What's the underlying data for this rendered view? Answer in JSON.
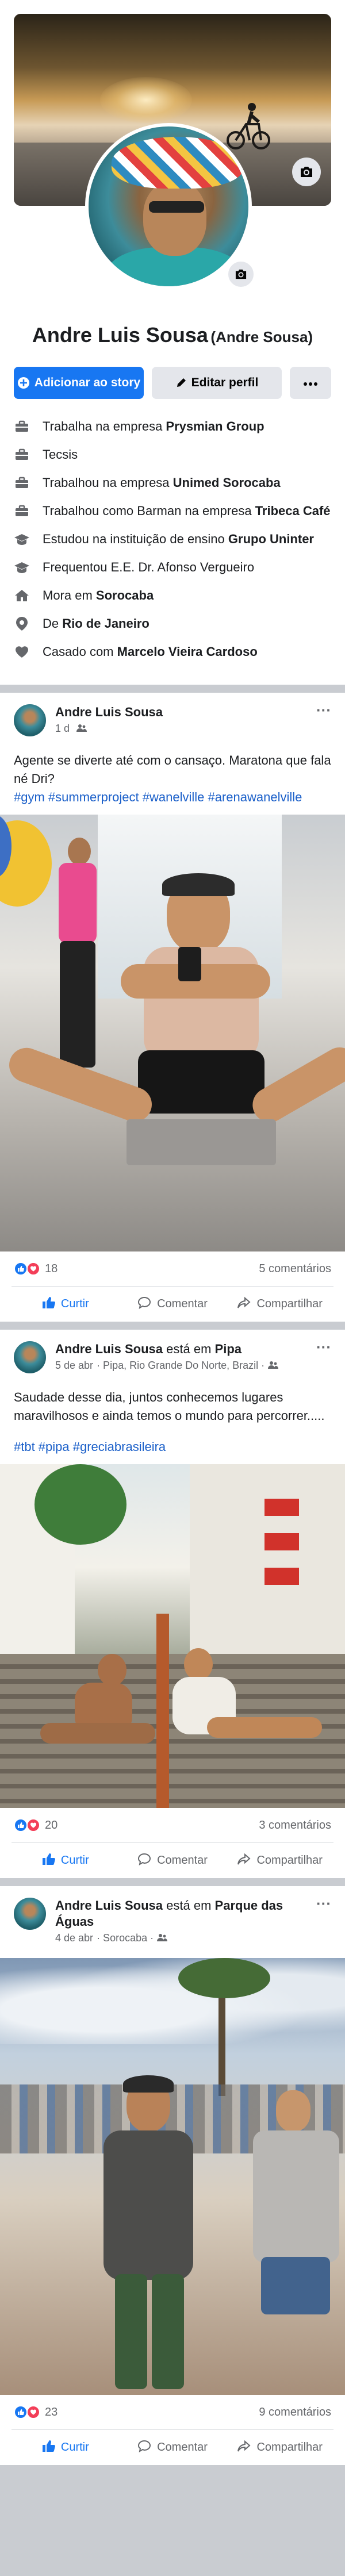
{
  "profile": {
    "name": "Andre Luis Sousa",
    "alternate_name": "(Andre Sousa)",
    "add_story_label": "Adicionar ao story",
    "edit_profile_label": "Editar perfil"
  },
  "about": [
    {
      "icon": "briefcase-icon",
      "prefix": "Trabalha na empresa ",
      "bold": "Prysmian Group"
    },
    {
      "icon": "briefcase-icon",
      "prefix": "Tecsis",
      "bold": ""
    },
    {
      "icon": "briefcase-icon",
      "prefix": "Trabalhou na empresa ",
      "bold": "Unimed Sorocaba"
    },
    {
      "icon": "briefcase-icon",
      "prefix": "Trabalhou como Barman na empresa ",
      "bold": "Tribeca Café"
    },
    {
      "icon": "graduation-cap-icon",
      "prefix": "Estudou na instituição de ensino ",
      "bold": "Grupo Uninter"
    },
    {
      "icon": "graduation-cap-icon",
      "prefix": "Frequentou E.E. Dr. Afonso Vergueiro",
      "bold": ""
    },
    {
      "icon": "home-icon",
      "prefix": "Mora em ",
      "bold": "Sorocaba"
    },
    {
      "icon": "location-pin-icon",
      "prefix": "De ",
      "bold": "Rio de Janeiro"
    },
    {
      "icon": "heart-icon",
      "prefix": "Casado com ",
      "bold": "Marcelo Vieira Cardoso"
    }
  ],
  "posts": [
    {
      "author": "Andre Luis Sousa",
      "place_prefix": "",
      "place": "",
      "date": "1 d",
      "location": "",
      "text": "Agente se diverte até com o cansaço. Maratona que fala né Dri?",
      "tags": "#gym #summerproject  #wanelville #arenawanelville",
      "reactions": "18",
      "comments": "5 comentários"
    },
    {
      "author": "Andre Luis Sousa",
      "place_prefix": " está em ",
      "place": "Pipa",
      "date": "5 de abr",
      "location": "· Pipa, Rio Grande Do Norte, Brazil ·",
      "text": "Saudade desse dia, juntos conhecemos lugares maravilhosos e ainda temos o mundo para percorrer.....",
      "tags": "#tbt #pipa #greciabrasileira",
      "reactions": "20",
      "comments": "3 comentários"
    },
    {
      "author": "Andre Luis Sousa",
      "place_prefix": " está em ",
      "place": "Parque das Águas",
      "date": "4 de abr",
      "location": "· Sorocaba ·",
      "text": "",
      "tags": "",
      "reactions": "23",
      "comments": "9 comentários"
    }
  ],
  "actions": {
    "like": "Curtir",
    "comment": "Comentar",
    "share": "Compartilhar"
  },
  "colors": {
    "accent": "#1877f2",
    "love": "#f33e58",
    "hashtag": "#1a5fc9"
  }
}
